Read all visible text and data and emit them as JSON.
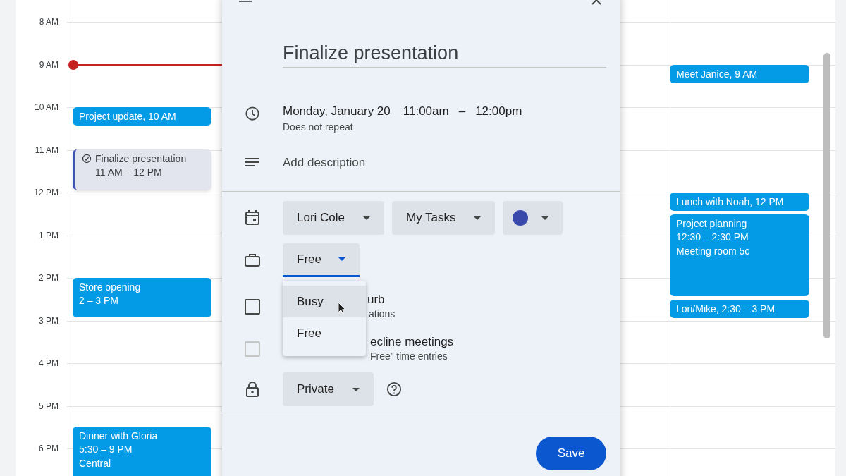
{
  "hours": [
    "8 AM",
    "9 AM",
    "10 AM",
    "11 AM",
    "12 PM",
    "1 PM",
    "2 PM",
    "3 PM",
    "4 PM",
    "5 PM",
    "6 PM"
  ],
  "columns": [
    {
      "events": [
        {
          "kind": "event",
          "title": "Project update, 10 AM"
        },
        {
          "kind": "task",
          "title": "Finalize presentation",
          "lines": [
            "11 AM – 12 PM"
          ]
        },
        {
          "kind": "event",
          "title": "Store opening",
          "lines": [
            "2 – 3 PM"
          ]
        },
        {
          "kind": "event",
          "title": "Dinner with Gloria",
          "lines": [
            "5:30 – 9 PM",
            "Central"
          ]
        }
      ]
    },
    {
      "events": [
        {
          "kind": "event",
          "title": "Meet Janice, 9 AM"
        },
        {
          "kind": "event",
          "title": "Lunch with Noah, 12 PM"
        },
        {
          "kind": "event",
          "title": "Project planning",
          "lines": [
            "12:30 – 2:30 PM",
            "Meeting room 5c"
          ]
        },
        {
          "kind": "event",
          "title": "Lori/Mike, 2:30 – 3 PM"
        }
      ]
    }
  ],
  "dialog": {
    "title": "Finalize presentation",
    "date": "Monday, January 20",
    "start_time": "11:00am",
    "separator": "–",
    "end_time": "12:00pm",
    "repeat": "Does not repeat",
    "description_placeholder": "Add description",
    "owner": "Lori Cole",
    "list": "My Tasks",
    "color": "#3949ab",
    "availability": "Free",
    "availability_menu": [
      {
        "label": "Busy",
        "highlighted": true
      },
      {
        "label": "Free",
        "highlighted": false
      }
    ],
    "options": [
      {
        "title": "urb",
        "subtitle": "ations",
        "checked": false,
        "disabled": false
      },
      {
        "title": "ecline meetings",
        "subtitle": "Free” time entries",
        "checked": false,
        "disabled": true
      }
    ],
    "visibility": "Private",
    "save": "Save"
  }
}
